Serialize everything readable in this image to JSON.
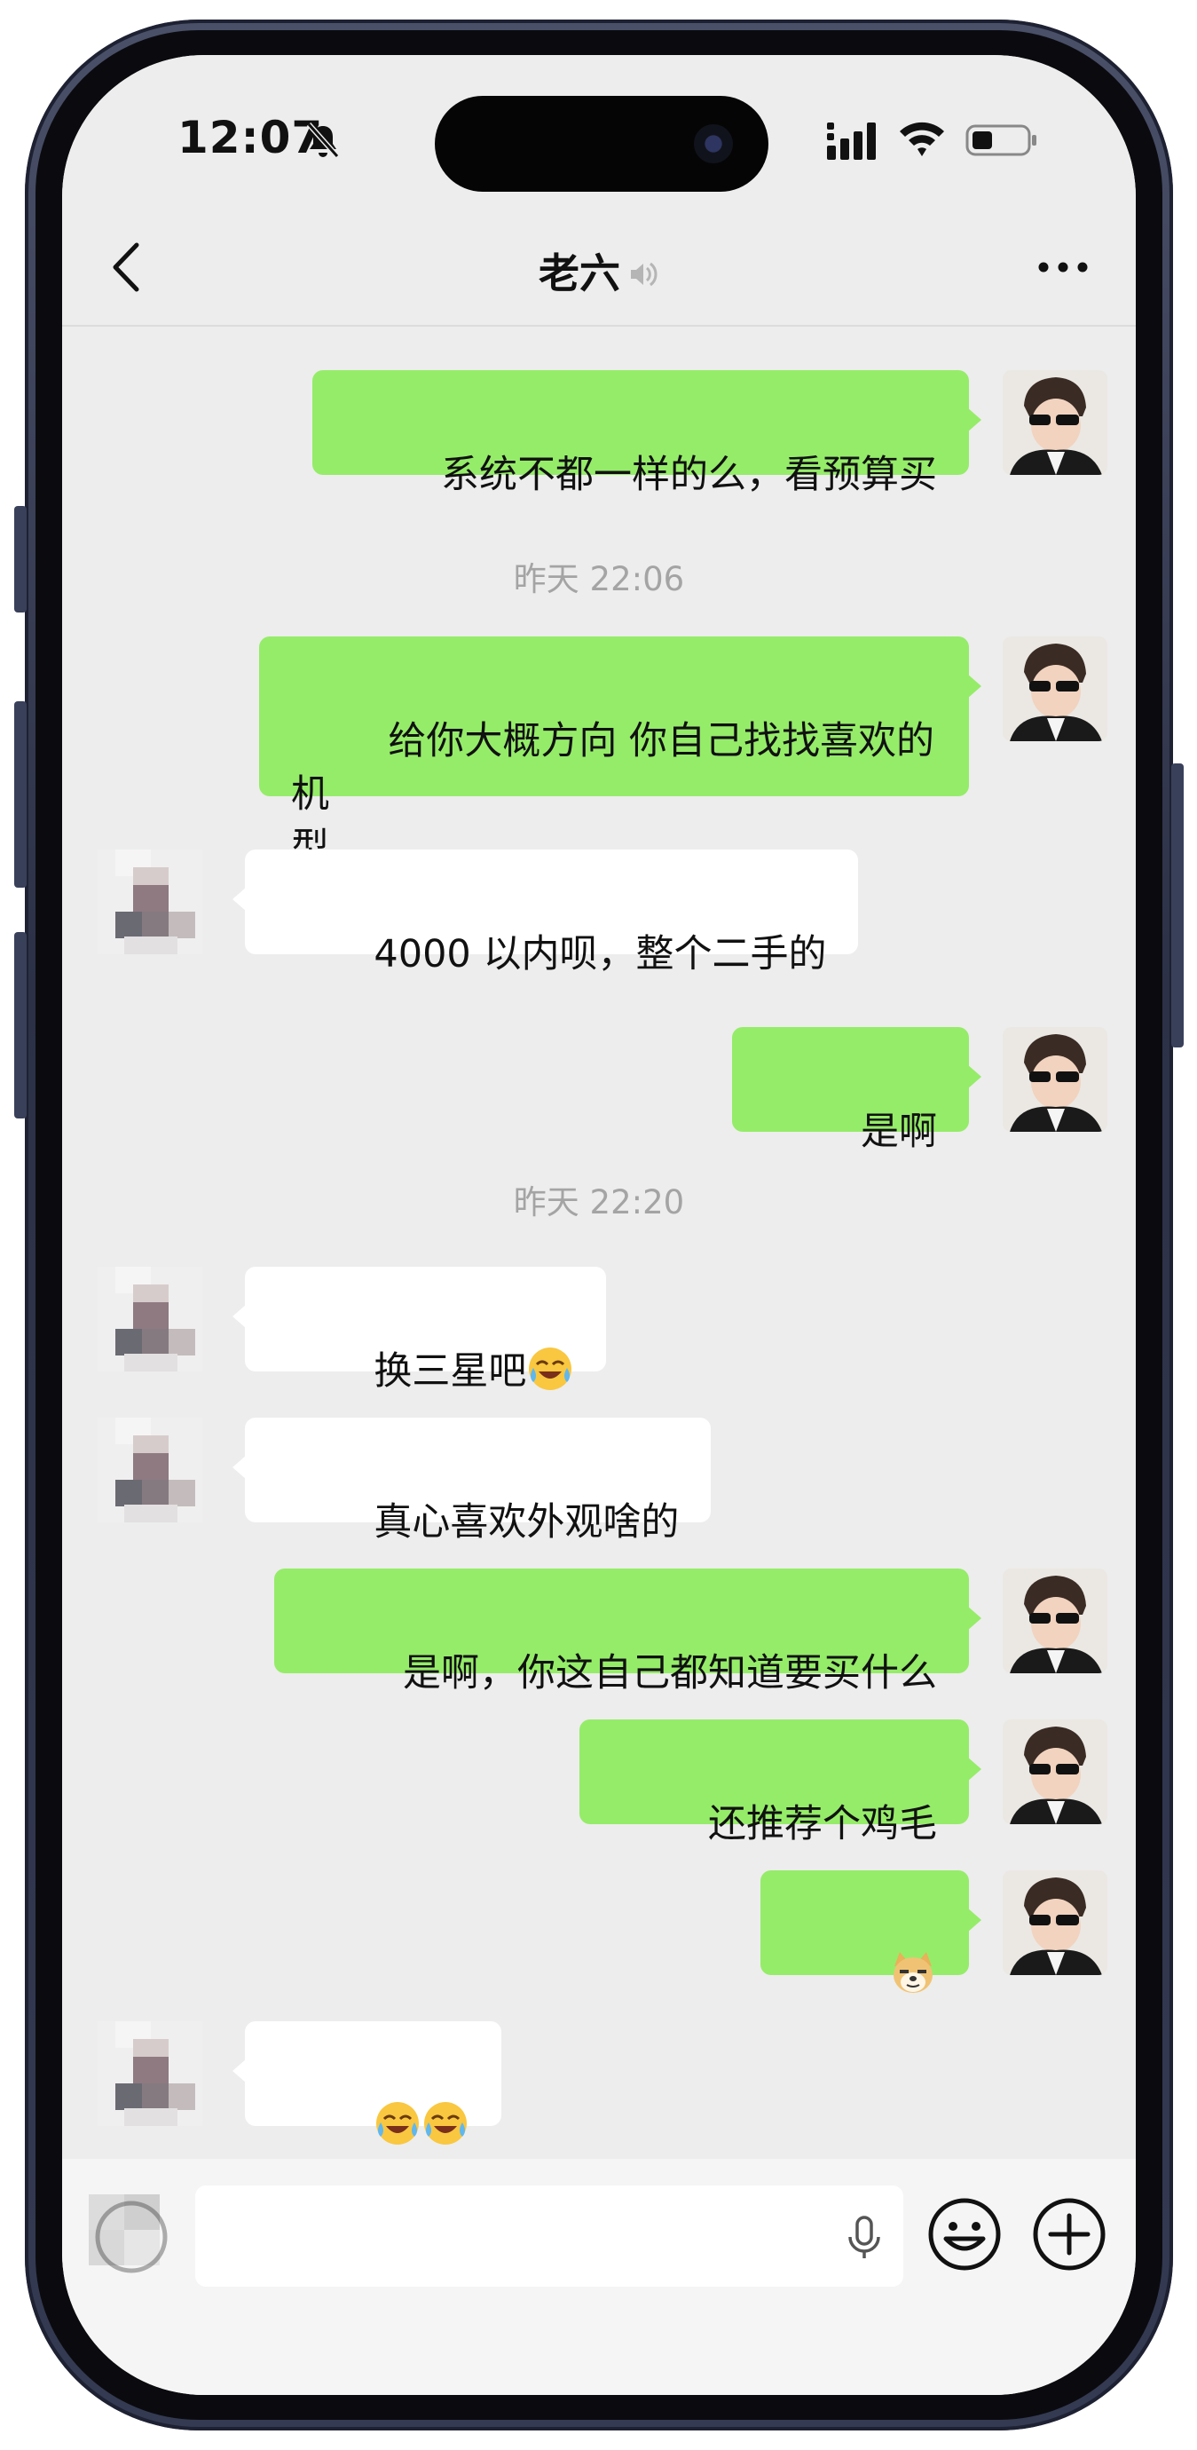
{
  "status_bar": {
    "time": "12:07",
    "icons": [
      "bell-slash-icon",
      "signal-icon",
      "wifi-icon",
      "battery-icon"
    ]
  },
  "header": {
    "title": "老六",
    "back_icon": "chevron-left-icon",
    "title_icon": "voice-speaker-icon",
    "more_icon": "ellipsis-icon"
  },
  "colors": {
    "chat_background": "#ededed",
    "self_bubble": "#95ec69",
    "other_bubble": "#ffffff",
    "timestamp_text": "#a4a4a4"
  },
  "messages": [
    {
      "sender": "self",
      "text": "系统不都一样的么，看预算买"
    },
    {
      "type": "timestamp",
      "text": "昨天 22:06"
    },
    {
      "sender": "self",
      "text": "给你大概方向 你自己找找喜欢的机\n型"
    },
    {
      "sender": "other",
      "text": "4000 以内呗，整个二手的"
    },
    {
      "sender": "self",
      "text": "是啊"
    },
    {
      "type": "timestamp",
      "text": "昨天 22:20"
    },
    {
      "sender": "other",
      "text": "换三星吧",
      "emoji": [
        "laughing-crying-emoji"
      ]
    },
    {
      "sender": "other",
      "text": "真心喜欢外观啥的"
    },
    {
      "sender": "self",
      "text": "是啊，你这自己都知道要买什么"
    },
    {
      "sender": "self",
      "text": "还推荐个鸡毛"
    },
    {
      "sender": "self",
      "text": "",
      "emoji": [
        "doge-emoji"
      ]
    },
    {
      "sender": "other",
      "text": "",
      "emoji": [
        "laughing-crying-emoji",
        "laughing-crying-emoji"
      ]
    }
  ],
  "input_bar": {
    "placeholder": "",
    "icons": [
      "voice-toggle-icon",
      "microphone-icon",
      "smiley-icon",
      "plus-icon"
    ]
  }
}
